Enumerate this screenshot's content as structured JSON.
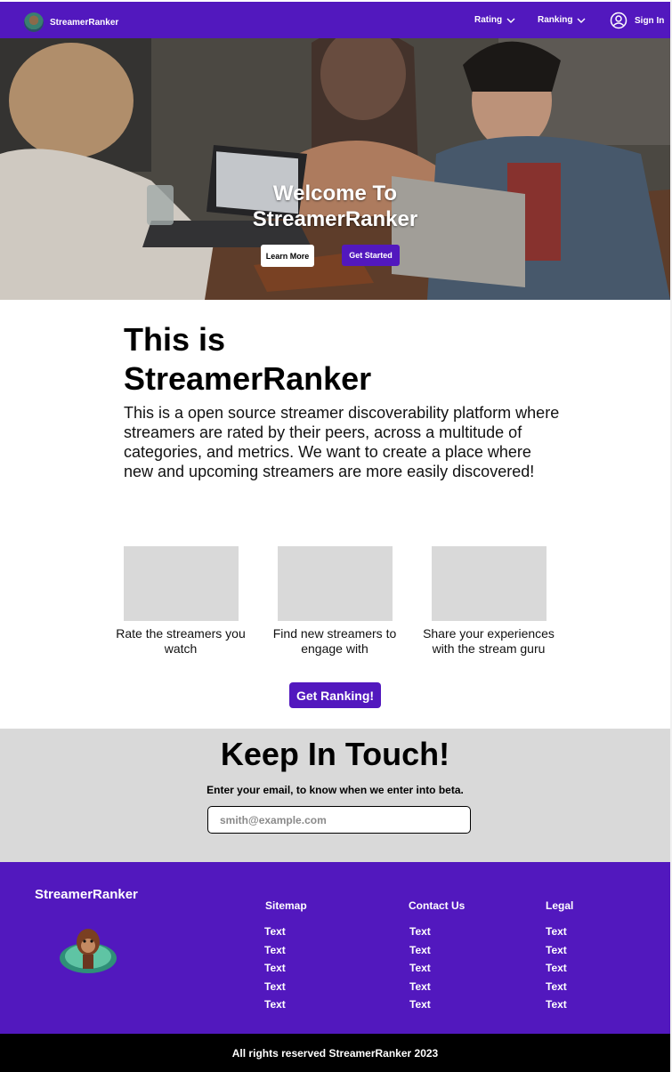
{
  "nav": {
    "brand": "StreamerRanker",
    "items": [
      {
        "label": "Rating"
      },
      {
        "label": "Ranking"
      }
    ],
    "signin_label": "Sign In"
  },
  "hero": {
    "title_line1": "Welcome To",
    "title_line2": "StreamerRanker",
    "learn_more": "Learn More",
    "get_started": "Get Started"
  },
  "about": {
    "title_line1": "This is",
    "title_line2": "StreamerRanker",
    "text": "This is a open source streamer discoverability platform where streamers are rated by their peers, across a multitude of categories, and metrics. We want to create a place where new and upcoming streamers are more easily discovered!"
  },
  "features": [
    {
      "caption": "Rate the streamers you watch"
    },
    {
      "caption": "Find new streamers to engage with"
    },
    {
      "caption": "Share your experiences with the stream guru"
    }
  ],
  "cta": {
    "label": "Get Ranking!"
  },
  "touch": {
    "title": "Keep In Touch!",
    "subtitle": "Enter your email, to know when we enter into beta.",
    "email_placeholder": "smith@example.com"
  },
  "footer": {
    "brand": "StreamerRanker",
    "columns": [
      {
        "heading": "Sitemap",
        "links": [
          "Text",
          "Text",
          "Text",
          "Text",
          "Text"
        ]
      },
      {
        "heading": "Contact Us",
        "links": [
          "Text",
          "Text",
          "Text",
          "Text",
          "Text"
        ]
      },
      {
        "heading": "Legal",
        "links": [
          "Text",
          "Text",
          "Text",
          "Text",
          "Text"
        ]
      }
    ],
    "copyright": "All rights reserved StreamerRanker 2023"
  },
  "colors": {
    "brand": "#5218be",
    "section_gray": "#d9d9d9",
    "footer_bottom": "#000000"
  },
  "icons": [
    "brand-avatar-icon",
    "chevron-down-icon",
    "user-circle-icon",
    "orangutan-logo"
  ]
}
